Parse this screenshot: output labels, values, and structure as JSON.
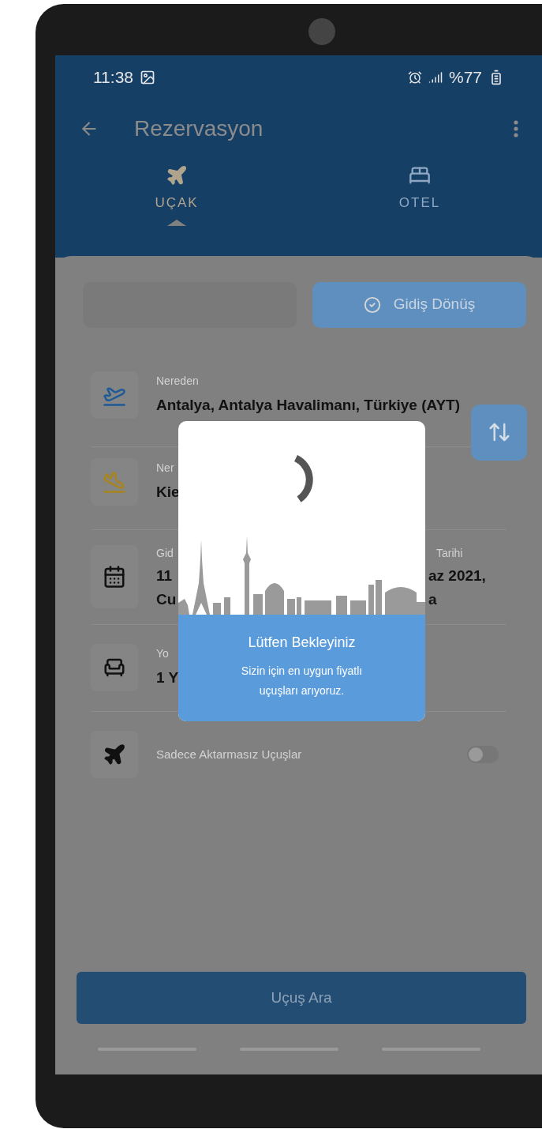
{
  "status_bar": {
    "time": "11:38",
    "battery": "%77"
  },
  "app_bar": {
    "title": "Rezervasyon"
  },
  "tabs": [
    {
      "label": "UÇAK",
      "selected": true,
      "kind": "plane"
    },
    {
      "label": "OTEL",
      "selected": false,
      "kind": "bed"
    }
  ],
  "trip_type": [
    {
      "selected": false
    },
    {
      "label": "Gidiş Dönüş",
      "selected": true
    }
  ],
  "route": [
    {
      "kind": "from",
      "label": "Nereden",
      "value": "Antalya, Antalya Havalimanı, Türkiye (AYT)"
    },
    {
      "kind": "to",
      "label": "Ner",
      "value": "Kie"
    }
  ],
  "dates": {
    "departure": {
      "label": "Gid",
      "lines": [
        "11",
        "Cu"
      ]
    },
    "return": {
      "label": "Tarihi",
      "lines": [
        "az 2021,",
        "a"
      ]
    }
  },
  "passengers": {
    "label": "Yo",
    "value": "1 Y"
  },
  "direct_only": {
    "label": "Sadece Aktarmasız Uçuşlar",
    "on": false
  },
  "search_button": "Uçuş Ara",
  "loading_dialog": {
    "title": "Lütfen Bekleyiniz",
    "message": "Sizin için en uygun fiyatlı uçuşları arıyoruz."
  }
}
